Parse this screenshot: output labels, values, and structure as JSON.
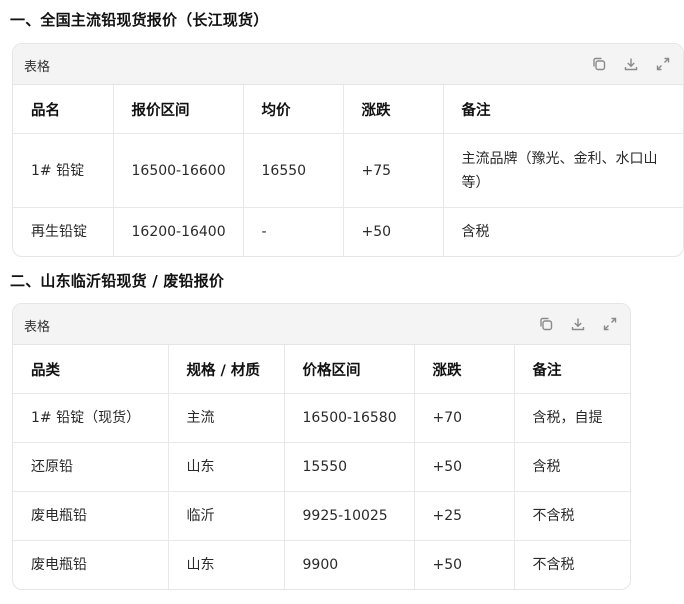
{
  "section1": {
    "heading": "一、全国主流铅现货报价（长江现货）",
    "card_title": "表格",
    "columns": [
      "品名",
      "报价区间",
      "均价",
      "涨跌",
      "备注"
    ],
    "rows": [
      [
        "1# 铅锭",
        "16500-16600",
        "16550",
        "+75",
        "主流品牌（豫光、金利、水口山等）"
      ],
      [
        "再生铅锭",
        "16200-16400",
        "-",
        "+50",
        "含税"
      ]
    ]
  },
  "section2": {
    "heading": "二、山东临沂铅现货 / 废铅报价",
    "card_title": "表格",
    "columns": [
      "品类",
      "规格 / 材质",
      "价格区间",
      "涨跌",
      "备注"
    ],
    "rows": [
      [
        "1# 铅锭（现货）",
        "主流",
        "16500-16580",
        "+70",
        "含税，自提"
      ],
      [
        "还原铅",
        "山东",
        "15550",
        "+50",
        "含税"
      ],
      [
        "废电瓶铅",
        "临沂",
        "9925-10025",
        "+25",
        "不含税"
      ],
      [
        "废电瓶铅",
        "山东",
        "9900",
        "+50",
        "不含税"
      ]
    ]
  },
  "icons": [
    "copy-icon",
    "download-icon",
    "expand-icon"
  ]
}
